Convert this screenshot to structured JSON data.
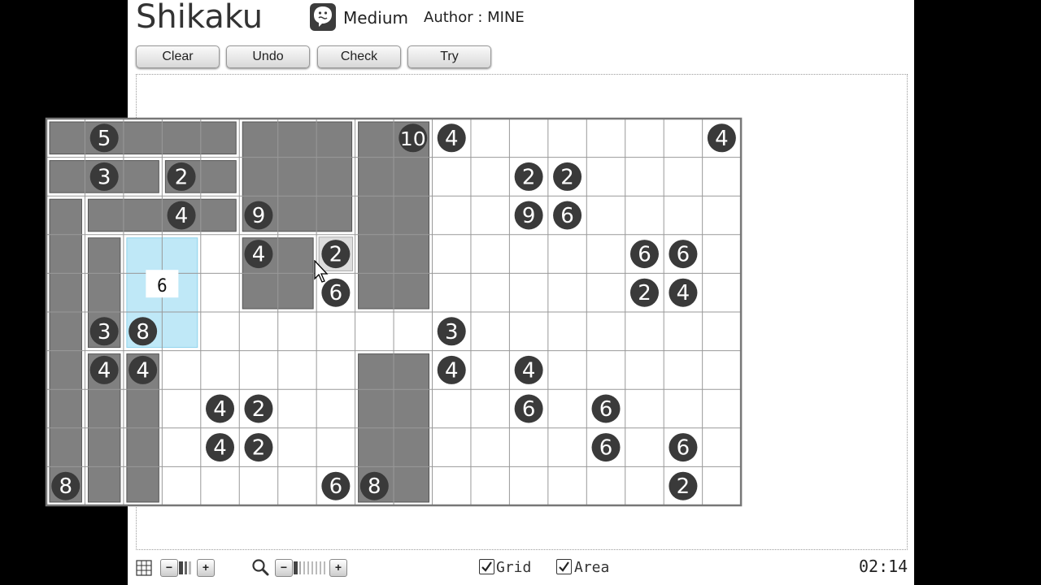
{
  "header": {
    "title": "Shikaku",
    "difficulty": "Medium",
    "author": "Author : MINE"
  },
  "toolbar": {
    "clear_label": "Clear",
    "undo_label": "Undo",
    "check_label": "Check",
    "try_label": "Try"
  },
  "board": {
    "columns": 18,
    "rows": 10,
    "clues": [
      {
        "row": 0,
        "col": 1,
        "value": "5"
      },
      {
        "row": 0,
        "col": 9,
        "value": "10"
      },
      {
        "row": 0,
        "col": 10,
        "value": "4"
      },
      {
        "row": 0,
        "col": 17,
        "value": "4"
      },
      {
        "row": 1,
        "col": 1,
        "value": "3"
      },
      {
        "row": 1,
        "col": 3,
        "value": "2"
      },
      {
        "row": 1,
        "col": 12,
        "value": "2"
      },
      {
        "row": 1,
        "col": 13,
        "value": "2"
      },
      {
        "row": 2,
        "col": 3,
        "value": "4"
      },
      {
        "row": 2,
        "col": 5,
        "value": "9"
      },
      {
        "row": 2,
        "col": 12,
        "value": "9"
      },
      {
        "row": 2,
        "col": 13,
        "value": "6"
      },
      {
        "row": 3,
        "col": 5,
        "value": "4"
      },
      {
        "row": 3,
        "col": 7,
        "value": "2"
      },
      {
        "row": 3,
        "col": 15,
        "value": "6"
      },
      {
        "row": 3,
        "col": 16,
        "value": "6"
      },
      {
        "row": 4,
        "col": 7,
        "value": "6"
      },
      {
        "row": 4,
        "col": 15,
        "value": "2"
      },
      {
        "row": 4,
        "col": 16,
        "value": "4"
      },
      {
        "row": 5,
        "col": 1,
        "value": "3"
      },
      {
        "row": 5,
        "col": 2,
        "value": "8"
      },
      {
        "row": 5,
        "col": 10,
        "value": "3"
      },
      {
        "row": 6,
        "col": 1,
        "value": "4"
      },
      {
        "row": 6,
        "col": 2,
        "value": "4"
      },
      {
        "row": 6,
        "col": 10,
        "value": "4"
      },
      {
        "row": 6,
        "col": 12,
        "value": "4"
      },
      {
        "row": 7,
        "col": 4,
        "value": "4"
      },
      {
        "row": 7,
        "col": 5,
        "value": "2"
      },
      {
        "row": 7,
        "col": 12,
        "value": "6"
      },
      {
        "row": 7,
        "col": 14,
        "value": "6"
      },
      {
        "row": 8,
        "col": 4,
        "value": "4"
      },
      {
        "row": 8,
        "col": 5,
        "value": "2"
      },
      {
        "row": 8,
        "col": 14,
        "value": "6"
      },
      {
        "row": 8,
        "col": 16,
        "value": "6"
      },
      {
        "row": 9,
        "col": 0,
        "value": "8"
      },
      {
        "row": 9,
        "col": 7,
        "value": "6"
      },
      {
        "row": 9,
        "col": 8,
        "value": "8"
      },
      {
        "row": 9,
        "col": 16,
        "value": "2"
      }
    ],
    "placed_areas": [
      {
        "row": 0,
        "col": 0,
        "rows": 1,
        "cols": 5
      },
      {
        "row": 1,
        "col": 0,
        "rows": 1,
        "cols": 3
      },
      {
        "row": 1,
        "col": 3,
        "rows": 1,
        "cols": 2
      },
      {
        "row": 2,
        "col": 1,
        "rows": 1,
        "cols": 4
      },
      {
        "row": 0,
        "col": 5,
        "rows": 3,
        "cols": 3
      },
      {
        "row": 0,
        "col": 8,
        "rows": 5,
        "cols": 2
      },
      {
        "row": 2,
        "col": 0,
        "rows": 8,
        "cols": 1
      },
      {
        "row": 3,
        "col": 1,
        "rows": 3,
        "cols": 1
      },
      {
        "row": 3,
        "col": 5,
        "rows": 2,
        "cols": 2
      },
      {
        "row": 6,
        "col": 1,
        "rows": 4,
        "cols": 1
      },
      {
        "row": 6,
        "col": 2,
        "rows": 4,
        "cols": 1
      },
      {
        "row": 6,
        "col": 8,
        "rows": 4,
        "cols": 2
      }
    ],
    "selected_cell": {
      "row": 3,
      "col": 7
    },
    "drag_selection": {
      "row": 3,
      "col": 2,
      "rows": 3,
      "cols": 2,
      "size_label": "6"
    }
  },
  "footer": {
    "grid_icon": "grid-icon",
    "zoom_icon": "magnifier-icon",
    "minus": "−",
    "plus": "+",
    "grid_label": "Grid",
    "grid_checked": true,
    "area_label": "Area",
    "area_checked": true,
    "timer": "02:14"
  },
  "colors": {
    "area_fill": "#808080",
    "clue_circle": "#3a3a3a",
    "selection": "#bfe8f7",
    "grid_line": "#999999"
  }
}
